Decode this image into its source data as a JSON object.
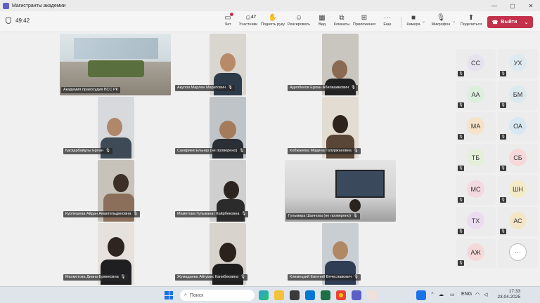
{
  "window": {
    "title": "Магистранты академии",
    "controls": [
      "—",
      "▢",
      "✕"
    ]
  },
  "toolbar": {
    "timer": "49:42",
    "participants_count": "47",
    "buttons": [
      {
        "label": "Чат",
        "icon": "chat-icon"
      },
      {
        "label": "Участники",
        "icon": "people-icon"
      },
      {
        "label": "Поднять руку",
        "icon": "raise-hand-icon"
      },
      {
        "label": "Реагировать",
        "icon": "react-icon"
      },
      {
        "label": "Вид",
        "icon": "view-icon"
      },
      {
        "label": "Комнаты",
        "icon": "rooms-icon"
      },
      {
        "label": "Приложения",
        "icon": "apps-icon"
      },
      {
        "label": "Еще",
        "icon": "more-icon"
      },
      {
        "label": "Камера",
        "icon": "camera-icon"
      },
      {
        "label": "Микрофон",
        "icon": "microphone-icon"
      },
      {
        "label": "Поделиться",
        "icon": "share-icon"
      }
    ],
    "leave_label": "Выйти"
  },
  "participants": [
    {
      "name": "Академия правосудия ВСС РК"
    },
    {
      "name": "Акулов Марлен Маратович"
    },
    {
      "name": "Адилбеков Ерлан Абилкаимович"
    },
    {
      "name": "Қасқарбайұлы Ерлан"
    },
    {
      "name": "Сакариев Ельнар (не проверено)"
    },
    {
      "name": "Кобжанова Мадина Галуржановна"
    },
    {
      "name": "Курпешева Айдан Амангельдиновна"
    },
    {
      "name": "Маметова Гульжанат Кайрбековна"
    },
    {
      "name": "Гульмира Шаянова (не проверено)"
    },
    {
      "name": "Махметова Диана Ермековна"
    },
    {
      "name": "Жумадаева Айгумис Канибековна"
    },
    {
      "name": "Климецкий Евгений Вячеславович"
    }
  ],
  "side_avatars": [
    {
      "initials": "СС",
      "color": "#e6e3ef"
    },
    {
      "initials": "УХ",
      "color": "#dfeaf0"
    },
    {
      "initials": "АА",
      "color": "#dcefdc"
    },
    {
      "initials": "БМ",
      "color": "#dce9ef"
    },
    {
      "initials": "МА",
      "color": "#f6e2c9"
    },
    {
      "initials": "ОА",
      "color": "#d8e8f3"
    },
    {
      "initials": "ТБ",
      "color": "#e3efd8"
    },
    {
      "initials": "СБ",
      "color": "#f6d8d8"
    },
    {
      "initials": "МС",
      "color": "#f3d9e0"
    },
    {
      "initials": "ШН",
      "color": "#f4ecc8"
    },
    {
      "initials": "ТХ",
      "color": "#ecdcf0"
    },
    {
      "initials": "АС",
      "color": "#f3e6c8"
    },
    {
      "initials": "АЖ",
      "color": "#f5d8d8"
    },
    {
      "initials": "···",
      "color": "#ffffff"
    }
  ],
  "taskbar": {
    "search_placeholder": "Поиск",
    "lang": "ENG",
    "time": "17:33",
    "date": "23.04.2025"
  },
  "colors": {
    "accent": "#5b5fc7",
    "leave": "#c4314b"
  }
}
